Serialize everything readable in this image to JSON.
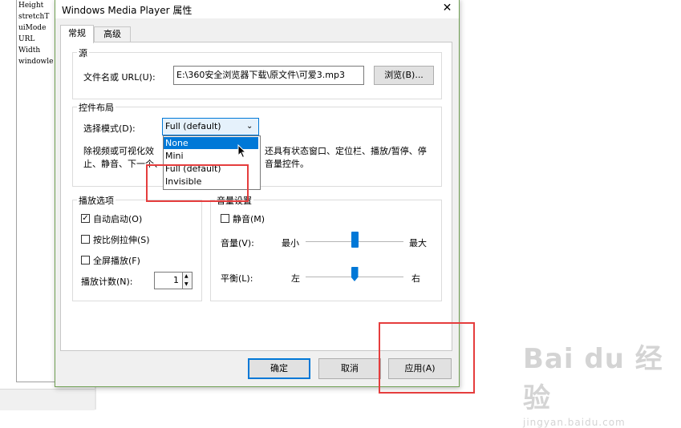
{
  "background_list": [
    "Height",
    "stretchT",
    "uiMode",
    "URL",
    "Width",
    "windowle"
  ],
  "dialog": {
    "title": "Windows Media Player 属性",
    "close_glyph": "✕",
    "tabs": [
      {
        "label": "常规"
      },
      {
        "label": "高级"
      }
    ],
    "source": {
      "legend": "源",
      "file_label": "文件名或 URL(U):",
      "file_value": "E:\\360安全浏览器下载\\原文件\\可爱3.mp3",
      "browse_button": "浏览(B)..."
    },
    "layout": {
      "legend": "控件布局",
      "mode_label": "选择模式(D):",
      "mode_value": "Full (default)",
      "desc_line1_a": "除视频或可视化效",
      "desc_line1_b": "还具有状态窗口、定位栏、播放/暂停、停",
      "desc_line2_a": "止、静音、下一个、",
      "desc_line2_b": "音量控件。",
      "dropdown_options": [
        "None",
        "Mini",
        "Full (default)",
        "Invisible"
      ],
      "dropdown_highlight_index": 0
    },
    "playback": {
      "legend": "播放选项",
      "autostart": {
        "label": "自动启动(O)",
        "checked": true
      },
      "stretch": {
        "label": "按比例拉伸(S)",
        "checked": false
      },
      "fullscreen": {
        "label": "全屏播放(F)",
        "checked": false
      },
      "count_label": "播放计数(N):",
      "count_value": "1"
    },
    "audio": {
      "legend": "音量设置",
      "mute": {
        "label": "静音(M)",
        "checked": false
      },
      "volume_label": "音量(V):",
      "volume_min": "最小",
      "volume_max": "最大",
      "volume_level": 0.5,
      "balance_label": "平衡(L):",
      "balance_left": "左",
      "balance_right": "右",
      "balance_level": 0.5
    },
    "buttons": {
      "ok": "确定",
      "cancel": "取消",
      "apply": "应用(A)"
    }
  },
  "colors": {
    "accent": "#0078d7",
    "highlight_box": "#e53d3d",
    "window_border": "#6f9f52"
  },
  "icons": {
    "close": "close-icon",
    "checkmark": "checkmark-icon",
    "spin_up": "spin-up-icon",
    "spin_down": "spin-down-icon",
    "chevron": "chevron-down-icon",
    "cursor": "mouse-cursor-icon"
  },
  "watermark": {
    "logo": "Bai du 经验",
    "url": "jingyan.baidu.com"
  }
}
